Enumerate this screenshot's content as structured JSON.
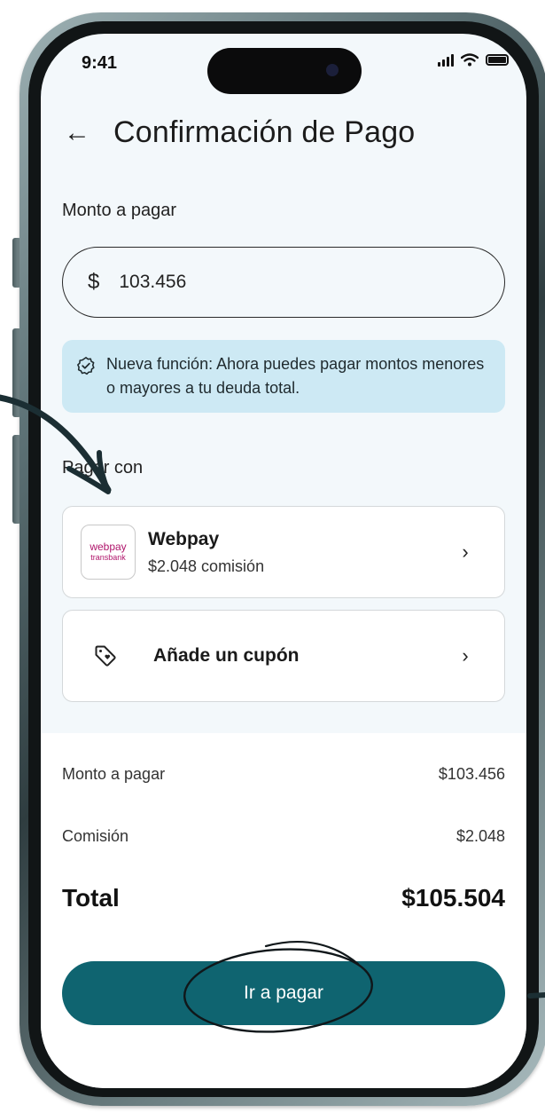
{
  "status_bar": {
    "time": "9:41"
  },
  "header": {
    "back_icon": "←",
    "title": "Confirmación de Pago"
  },
  "amount": {
    "label": "Monto a pagar",
    "currency_symbol": "$",
    "value": "103.456"
  },
  "notice": {
    "text": "Nueva función: Ahora puedes pagar montos menores o mayores a tu deuda total."
  },
  "payment": {
    "label": "Pagar con",
    "method": {
      "logo_line1": "webpay",
      "logo_line2": "transbank",
      "name": "Webpay",
      "fee": "$2.048 comisión"
    },
    "coupon_label": "Añade un cupón",
    "chevron": "›"
  },
  "summary": {
    "rows": [
      {
        "label": "Monto a pagar",
        "value": "$103.456"
      },
      {
        "label": "Comisión",
        "value": "$2.048"
      }
    ],
    "total_label": "Total",
    "total_value": "$105.504"
  },
  "pay_button": {
    "label": "Ir a pagar"
  },
  "colors": {
    "primary": "#0f6470",
    "notice_bg": "#cde9f4",
    "screen_bg": "#f3f8fb",
    "webpay_brand": "#b0156b"
  }
}
